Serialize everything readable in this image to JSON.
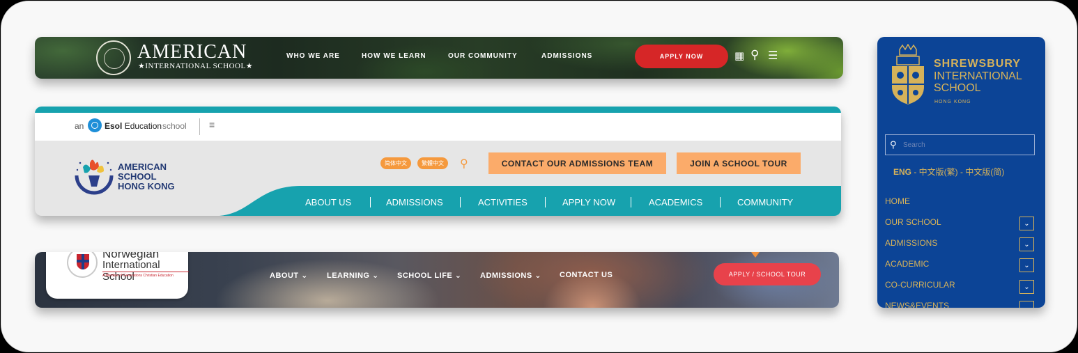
{
  "aisc": {
    "brand_line1": "AMERICAN",
    "brand_line2": "★INTERNATIONAL SCHOOL★",
    "nav": [
      "WHO WE ARE",
      "HOW WE LEARN",
      "OUR COMMUNITY",
      "ADMISSIONS"
    ],
    "apply": "APPLY NOW",
    "calendar_icon": "▦",
    "search_icon": "⚲",
    "menu_icon": "☰",
    "accent": "#d62627"
  },
  "ashk": {
    "an": "an",
    "esol_bold": "Esol",
    "esol_rest": "Education",
    "school": "school",
    "menu_icon": "≡",
    "logo_lines": [
      "AMERICAN",
      "SCHOOL",
      "HONG KONG"
    ],
    "lang_simplified": "简体中文",
    "lang_traditional": "繁體中文",
    "search_icon": "⚲",
    "contact": "CONTACT OUR ADMISSIONS TEAM",
    "tour": "JOIN A SCHOOL TOUR",
    "nav": [
      "ABOUT US",
      "ADMISSIONS",
      "ACTIVITIES",
      "APPLY NOW",
      "ACADEMICS",
      "COMMUNITY"
    ],
    "teal": "#17a2ae",
    "orange": "#fbab6a"
  },
  "nis": {
    "name1": "Norwegian",
    "name2": "International School",
    "tagline": "A Member of Generations Christian Education",
    "nav": [
      "ABOUT ⌄",
      "LEARNING ⌄",
      "SCHOOL LIFE ⌄",
      "ADMISSIONS ⌄",
      "CONTACT US"
    ],
    "apply": "APPLY / SCHOOL TOUR",
    "accent": "#e8424b"
  },
  "sis": {
    "name1": "SHREWSBURY",
    "name2": "INTERNATIONAL",
    "name3": "SCHOOL",
    "city": "HONG KONG",
    "search_placeholder": "Search",
    "lang_eng": "ENG",
    "lang_rest": " - 中文版(繁) - 中文版(简)",
    "menu": [
      "HOME",
      "OUR SCHOOL",
      "ADMISSIONS",
      "ACADEMIC",
      "CO-CURRICULAR",
      "NEWS&EVENTS"
    ],
    "dropdown_icon": "⌄",
    "navy": "#0c4496",
    "gold": "#d6b25a"
  }
}
